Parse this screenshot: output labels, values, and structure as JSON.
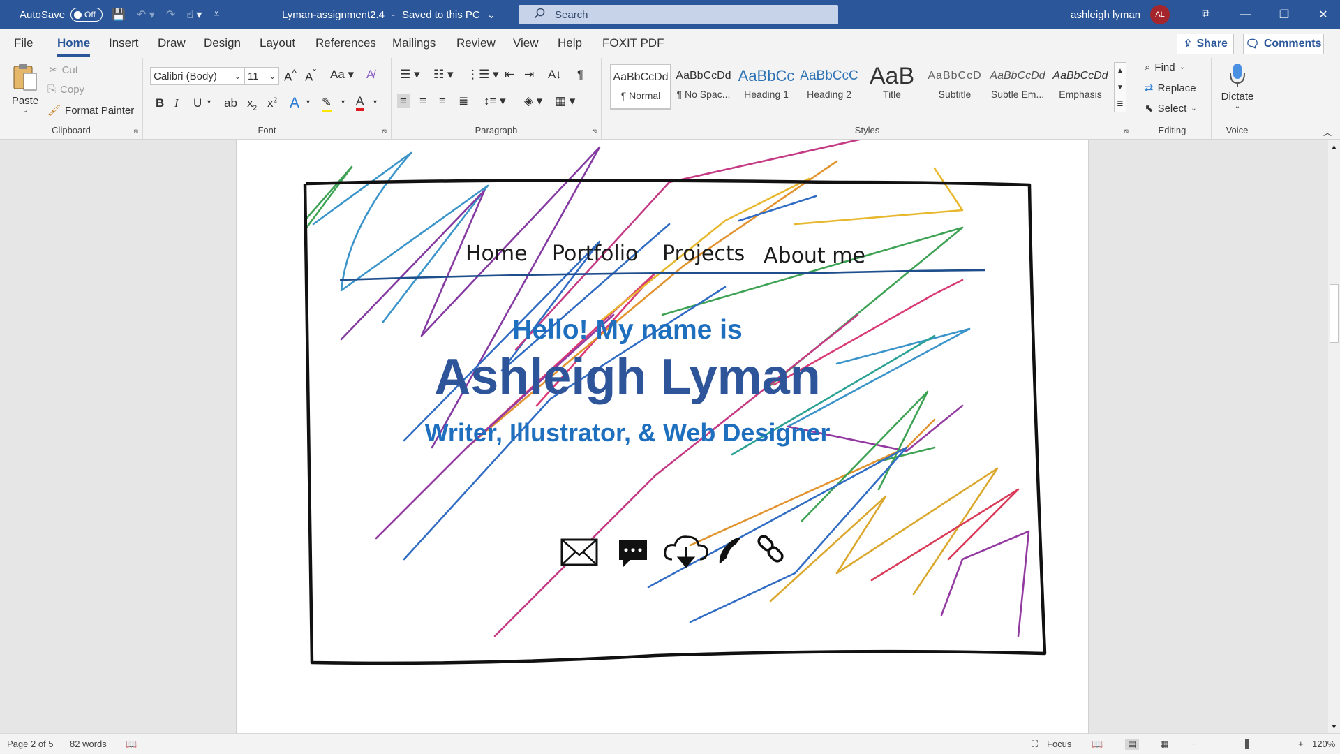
{
  "titlebar": {
    "autosave_label": "AutoSave",
    "autosave_state": "Off",
    "doc_title": "Lyman-assignment2.4",
    "save_status": "Saved to this PC",
    "search_placeholder": "Search",
    "user_name": "ashleigh lyman",
    "user_initials": "AL"
  },
  "tabs": [
    "File",
    "Home",
    "Insert",
    "Draw",
    "Design",
    "Layout",
    "References",
    "Mailings",
    "Review",
    "View",
    "Help",
    "FOXIT PDF"
  ],
  "active_tab": "Home",
  "share_label": "Share",
  "comments_label": "Comments",
  "clipboard": {
    "label": "Clipboard",
    "paste": "Paste",
    "cut": "Cut",
    "copy": "Copy",
    "format_painter": "Format Painter"
  },
  "font": {
    "label": "Font",
    "family": "Calibri (Body)",
    "size": "11"
  },
  "paragraph": {
    "label": "Paragraph"
  },
  "styles": {
    "label": "Styles",
    "items": [
      {
        "preview": "AaBbCcDd",
        "name": "¶ Normal"
      },
      {
        "preview": "AaBbCcDd",
        "name": "¶ No Spac..."
      },
      {
        "preview": "AaBbCc",
        "name": "Heading 1"
      },
      {
        "preview": "AaBbCcC",
        "name": "Heading 2"
      },
      {
        "preview": "AaB",
        "name": "Title"
      },
      {
        "preview": "AaBbCcD",
        "name": "Subtitle"
      },
      {
        "preview": "AaBbCcDd",
        "name": "Subtle Em..."
      },
      {
        "preview": "AaBbCcDd",
        "name": "Emphasis"
      }
    ]
  },
  "editing": {
    "label": "Editing",
    "find": "Find",
    "replace": "Replace",
    "select": "Select"
  },
  "voice": {
    "label": "Voice",
    "dictate": "Dictate"
  },
  "document": {
    "nav_links": [
      "Home",
      "Portfolio",
      "Projects",
      "About me"
    ],
    "hello": "Hello! My name is",
    "name": "Ashleigh Lyman",
    "role": "Writer, Illustrator, & Web Designer",
    "icons": [
      "envelope-icon",
      "chat-bubble-icon",
      "cloud-download-icon",
      "phone-icon",
      "link-icon"
    ],
    "accent_blue": "#1f6fbf",
    "name_blue": "#2e5599"
  },
  "status": {
    "page": "Page 2 of 5",
    "words": "82 words",
    "focus": "Focus",
    "zoom": "120%"
  },
  "colors": {
    "word_blue": "#2b579a"
  }
}
